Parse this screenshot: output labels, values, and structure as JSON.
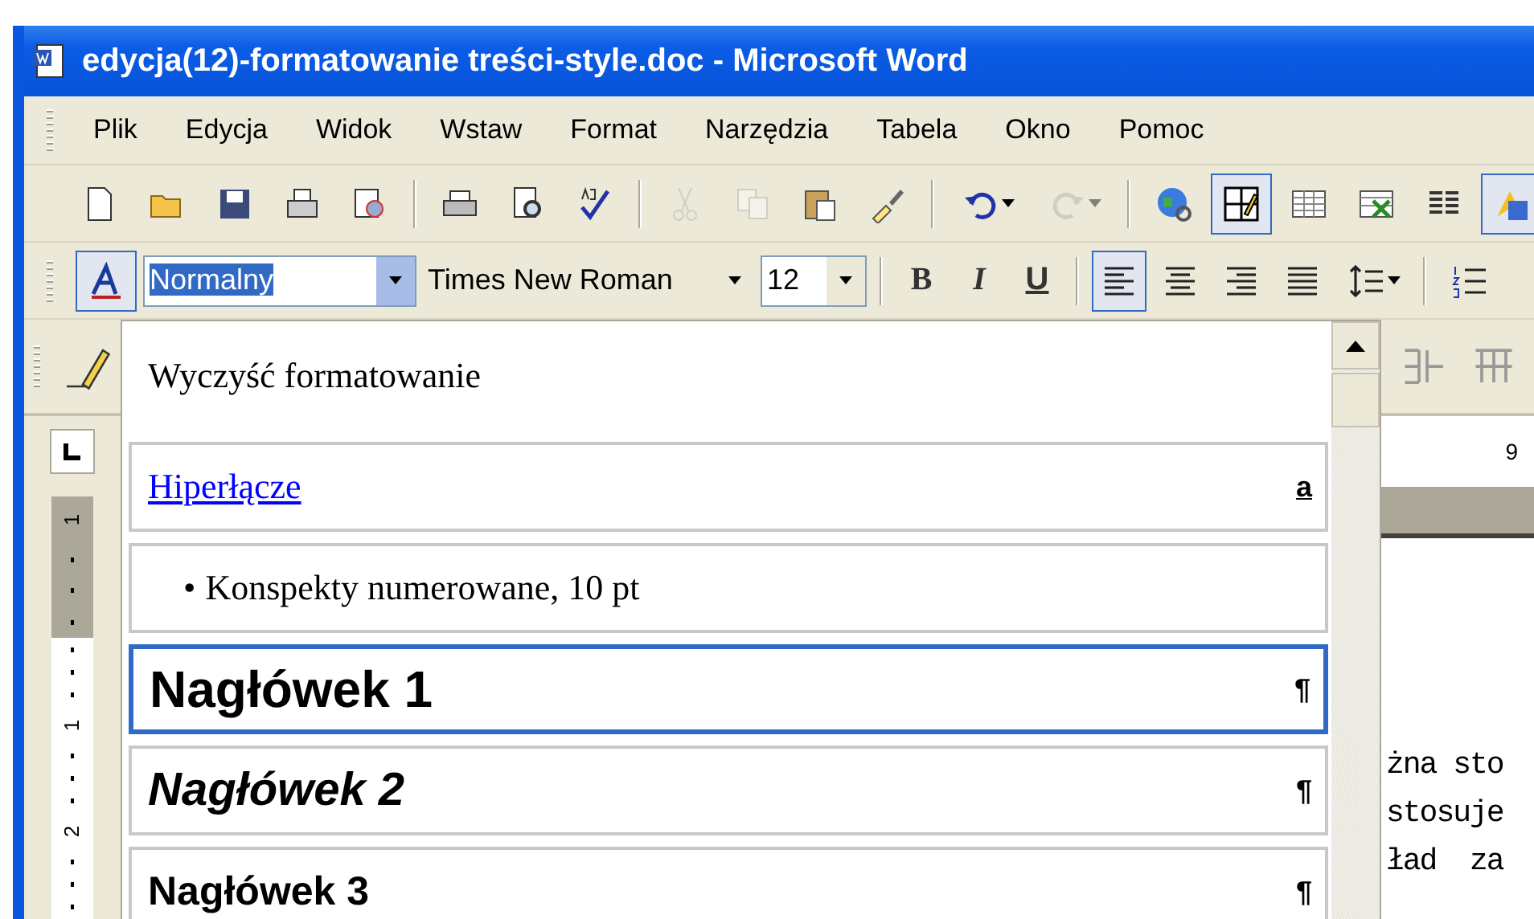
{
  "window": {
    "title": "edycja(12)-formatowanie treści-style.doc - Microsoft Word"
  },
  "menu": [
    "Plik",
    "Edycja",
    "Widok",
    "Wstaw",
    "Format",
    "Narzędzia",
    "Tabela",
    "Okno",
    "Pomoc"
  ],
  "standard_toolbar": [
    {
      "kind": "new",
      "pressed": false,
      "disabled": false
    },
    {
      "kind": "open",
      "pressed": false,
      "disabled": false
    },
    {
      "kind": "save",
      "pressed": false,
      "disabled": false
    },
    {
      "kind": "permission",
      "pressed": false,
      "disabled": false
    },
    {
      "kind": "research",
      "pressed": false,
      "disabled": false
    },
    {
      "kind": "sep"
    },
    {
      "kind": "print",
      "pressed": false,
      "disabled": false
    },
    {
      "kind": "preview",
      "pressed": false,
      "disabled": false
    },
    {
      "kind": "spelling",
      "pressed": false,
      "disabled": false
    },
    {
      "kind": "sep"
    },
    {
      "kind": "cut",
      "pressed": false,
      "disabled": true
    },
    {
      "kind": "copy",
      "pressed": false,
      "disabled": true
    },
    {
      "kind": "paste",
      "pressed": false,
      "disabled": false
    },
    {
      "kind": "brush",
      "pressed": false,
      "disabled": false
    },
    {
      "kind": "sep"
    },
    {
      "kind": "undo",
      "pressed": false,
      "disabled": false
    },
    {
      "kind": "redo",
      "pressed": false,
      "disabled": true
    },
    {
      "kind": "sep"
    },
    {
      "kind": "globe",
      "pressed": false,
      "disabled": false
    },
    {
      "kind": "draw-table",
      "pressed": true,
      "disabled": false
    },
    {
      "kind": "table",
      "pressed": false,
      "disabled": false
    },
    {
      "kind": "sheet",
      "pressed": false,
      "disabled": false
    },
    {
      "kind": "columns",
      "pressed": false,
      "disabled": false
    },
    {
      "kind": "shapes",
      "pressed": true,
      "disabled": false
    }
  ],
  "formatting_toolbar": {
    "styles_pane": {
      "pressed": true
    },
    "style": "Normalny",
    "font": "Times New Roman",
    "size": "12",
    "bold": "B",
    "italic": "I",
    "underline": "U",
    "alignment": [
      {
        "kind": "left",
        "selected": true
      },
      {
        "kind": "center",
        "selected": false
      },
      {
        "kind": "right",
        "selected": false
      },
      {
        "kind": "justify",
        "selected": false
      }
    ]
  },
  "style_list": {
    "items": [
      {
        "kind": "clear",
        "label": "Wyczyść formatowanie",
        "selected": false
      },
      {
        "kind": "link",
        "label": "Hiperłącze",
        "mark": "a",
        "selected": false
      },
      {
        "kind": "list",
        "bullet": "•",
        "label": "Konspekty numerowane, 10 pt",
        "selected": false
      },
      {
        "kind": "heading1",
        "label": "Nagłówek 1",
        "mark": "¶",
        "selected": true
      },
      {
        "kind": "heading2",
        "label": "Nagłówek 2",
        "mark": "¶",
        "selected": false
      },
      {
        "kind": "heading3",
        "label": "Nagłówek 3",
        "mark": "¶",
        "selected": false
      }
    ]
  },
  "horizontal_ruler": [
    "9"
  ],
  "vertical_ruler": [
    "1",
    "1",
    "2"
  ],
  "document": {
    "lines": [
      "żna sto",
      "stosuje",
      "ład  za"
    ]
  }
}
